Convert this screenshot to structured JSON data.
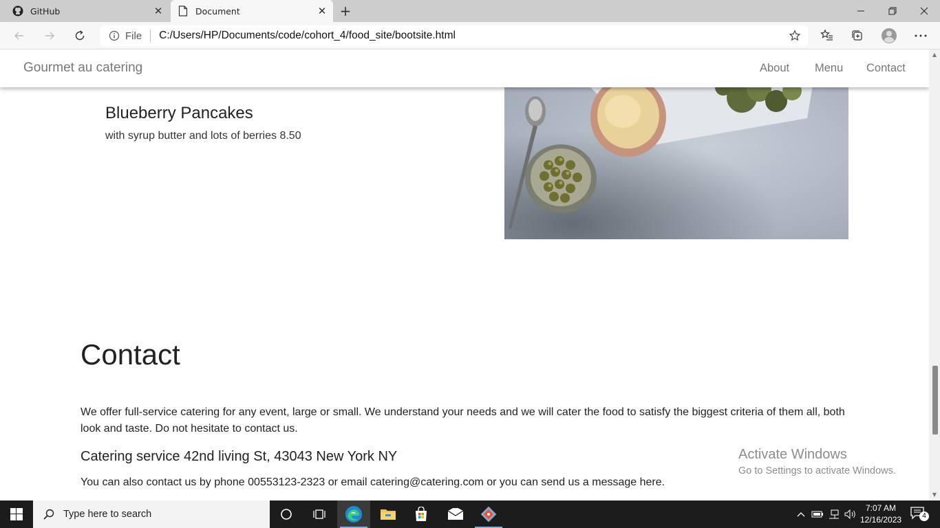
{
  "browser": {
    "tabs": [
      {
        "title": "GitHub",
        "icon": "github-icon"
      },
      {
        "title": "Document",
        "icon": "document-icon"
      }
    ],
    "new_tab_symbol": "+",
    "address": {
      "info_label": "File",
      "url": "C:/Users/HP/Documents/code/cohort_4/food_site/bootsite.html"
    }
  },
  "site": {
    "brand": "Gourmet au catering",
    "nav": [
      "About",
      "Menu",
      "Contact"
    ],
    "menu_item": {
      "title": "Blueberry Pancakes",
      "description": "with syrup butter and lots of berries 8.50"
    },
    "contact": {
      "title": "Contact",
      "text": "We offer full-service catering for any event, large or small. We understand your needs and we will cater the food to satisfy the biggest criteria of them all, both look and taste. Do not hesitate to contact us.",
      "address": "Catering service 42nd living St, 43043 New York NY",
      "phone_line": "You can also contact us by phone 00553123-2323 or email catering@catering.com or you can send us a message here."
    }
  },
  "watermark": {
    "line1": "Activate Windows",
    "line2": "Go to Settings to activate Windows."
  },
  "taskbar": {
    "search_placeholder": "Type here to search",
    "time": "7:07 AM",
    "date": "12/16/2023",
    "notification_count": "4"
  },
  "colors": {
    "tab_strip": "#cdcdcd",
    "toolbar": "#f7f7f7",
    "taskbar": "#1c1c1c",
    "nav_text": "#777777"
  }
}
